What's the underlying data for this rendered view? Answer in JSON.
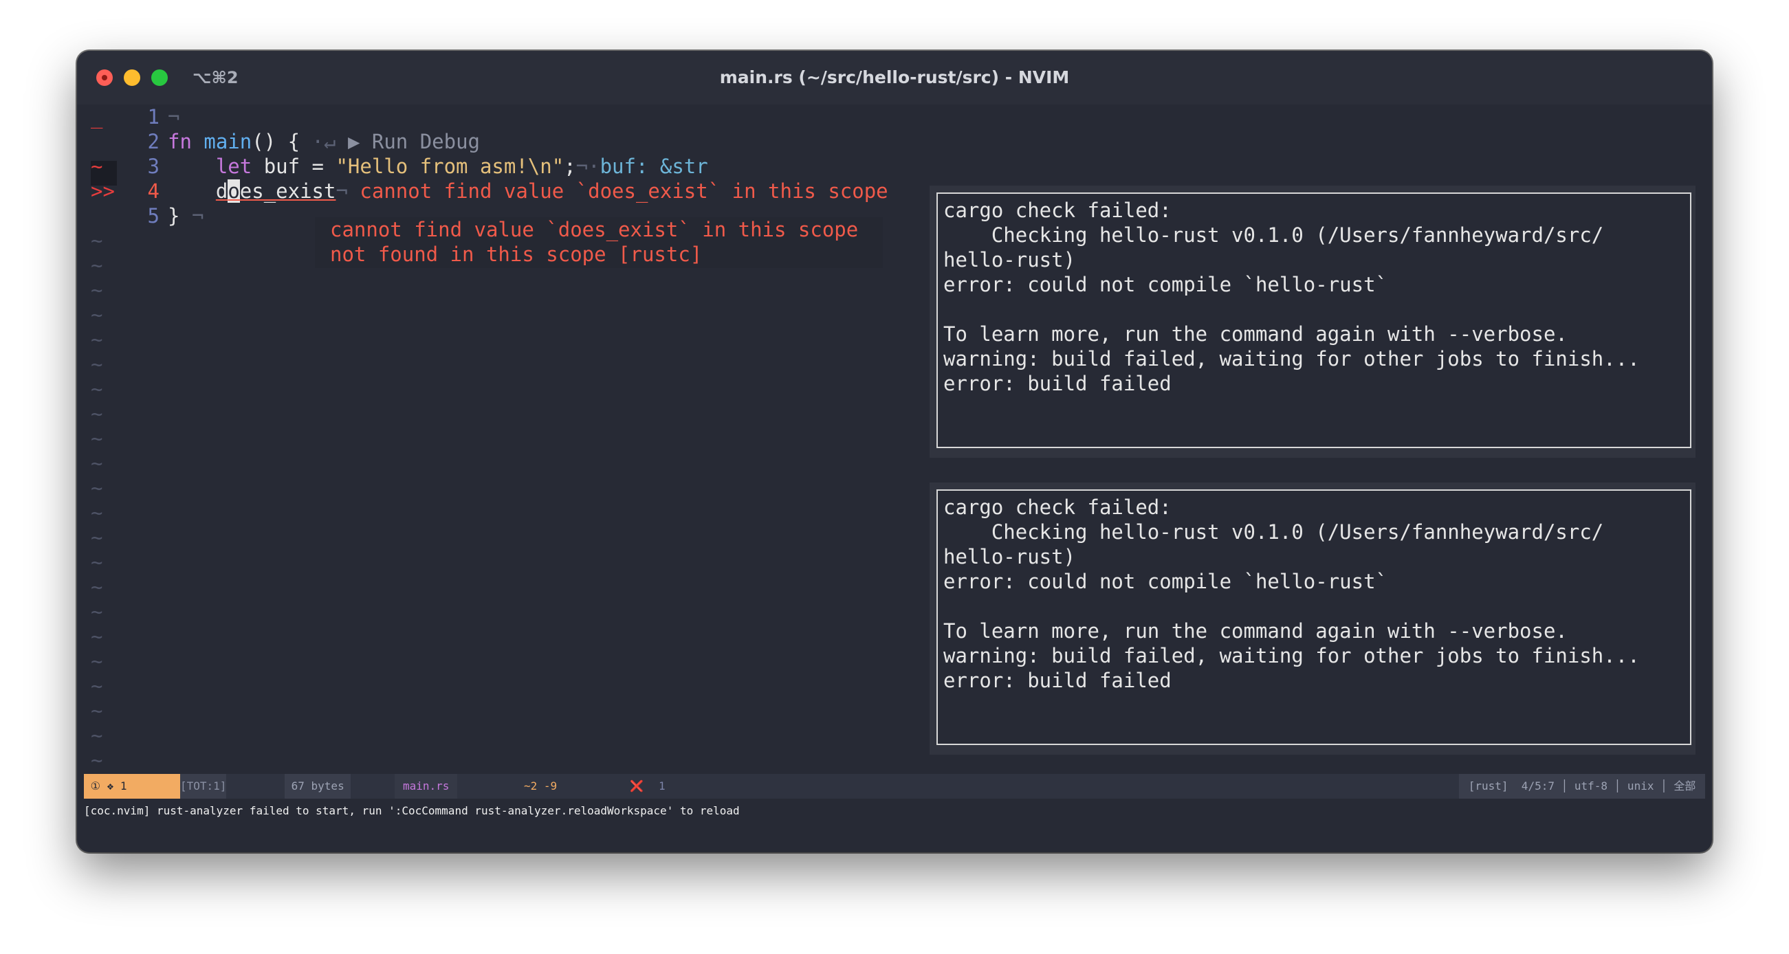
{
  "window": {
    "title": "main.rs (~/src/hello-rust/src) - NVIM",
    "shortcut": "⌥⌘2"
  },
  "editor": {
    "signs": {
      "line1": "_",
      "line3": "~",
      "line4": ">>"
    },
    "line_numbers": [
      "1",
      "2",
      "3",
      "4",
      "5"
    ],
    "line1": {
      "eol": "¬"
    },
    "line2": {
      "kw": "fn",
      "name": "main",
      "rest": "() {",
      "eol": "·↵",
      "lens": "▶ Run Debug"
    },
    "line3": {
      "indent": "    ",
      "kw": "let",
      "mid": " buf = ",
      "str": "\"Hello from asm!\\n\"",
      "semi": ";",
      "eol": "¬·",
      "hint": "buf: &str"
    },
    "line4": {
      "indent": "    ",
      "pre": "d",
      "cursor": "o",
      "post": "es_exist",
      "eol": "¬",
      "virtual_error": "cannot find value `does_exist` in this scope"
    },
    "line5": {
      "text": "}",
      "eol": "¬"
    },
    "tilde": "~",
    "error_float": [
      "cannot find value `does_exist` in this scope",
      "not found in this scope [rustc]"
    ]
  },
  "panels": [
    {
      "lines": [
        "cargo check failed:",
        "    Checking hello-rust v0.1.0 (/Users/fannheyward/src/",
        "hello-rust)",
        "error: could not compile `hello-rust`",
        "",
        "To learn more, run the command again with --verbose.",
        "warning: build failed, waiting for other jobs to finish...",
        "error: build failed"
      ]
    },
    {
      "lines": [
        "cargo check failed:",
        "    Checking hello-rust v0.1.0 (/Users/fannheyward/src/",
        "hello-rust)",
        "error: could not compile `hello-rust`",
        "",
        "To learn more, run the command again with --verbose.",
        "warning: build failed, waiting for other jobs to finish...",
        "error: build failed"
      ]
    }
  ],
  "statusline": {
    "mode": " ① ❖ 1 ",
    "tot": "[TOT:1]",
    "bytes": " 67 bytes ",
    "file": "main.rs",
    "diff": "~2 -9",
    "error_icon": "❌",
    "error_count": "1",
    "right": " [rust]  4/5:7 │ utf-8 │ unix │ 全部 "
  },
  "cmdline": "[coc.nvim] rust-analyzer failed to start, run ':CocCommand rust-analyzer.reloadWorkspace' to reload",
  "colors": {
    "background": "#272a35",
    "error": "#f05a4a",
    "mode_bg": "#f2ab62",
    "keyword": "#c678dd",
    "function": "#61afef",
    "string": "#e5c07b"
  }
}
